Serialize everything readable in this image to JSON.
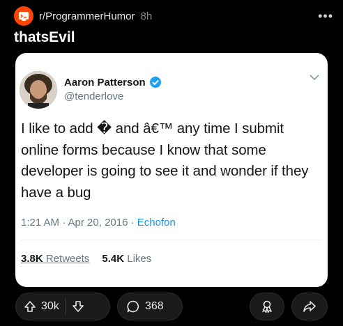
{
  "post": {
    "subreddit": "r/ProgrammerHumor",
    "age": "8h",
    "title": "thatsEvil"
  },
  "tweet": {
    "author_name": "Aaron Patterson",
    "handle": "@tenderlove",
    "text": "I like to add � and â€™ any time I submit online forms because I know that some developer is going to see it and wonder if they have a bug",
    "timestamp": "1:21 AM · Apr 20, 2016 · ",
    "source": "Echofon",
    "retweets_count": "3.8K",
    "retweets_label": " Retweets",
    "likes_count": "5.4K",
    "likes_label": " Likes"
  },
  "actions": {
    "upvotes": "30k",
    "comments": "368"
  },
  "icons": {
    "subreddit": "subreddit-icon",
    "more": "more-options-icon",
    "verified": "verified-badge-icon",
    "caret": "chevron-down-icon",
    "upvote": "upvote-arrow-icon",
    "downvote": "downvote-arrow-icon",
    "comment": "comment-bubble-icon",
    "award": "award-icon",
    "share": "share-icon"
  },
  "colors": {
    "background": "#000000",
    "subreddit_icon": "#ff4500",
    "twitter_blue": "#1b95e0",
    "pill_bg": "#1a1a1b"
  }
}
